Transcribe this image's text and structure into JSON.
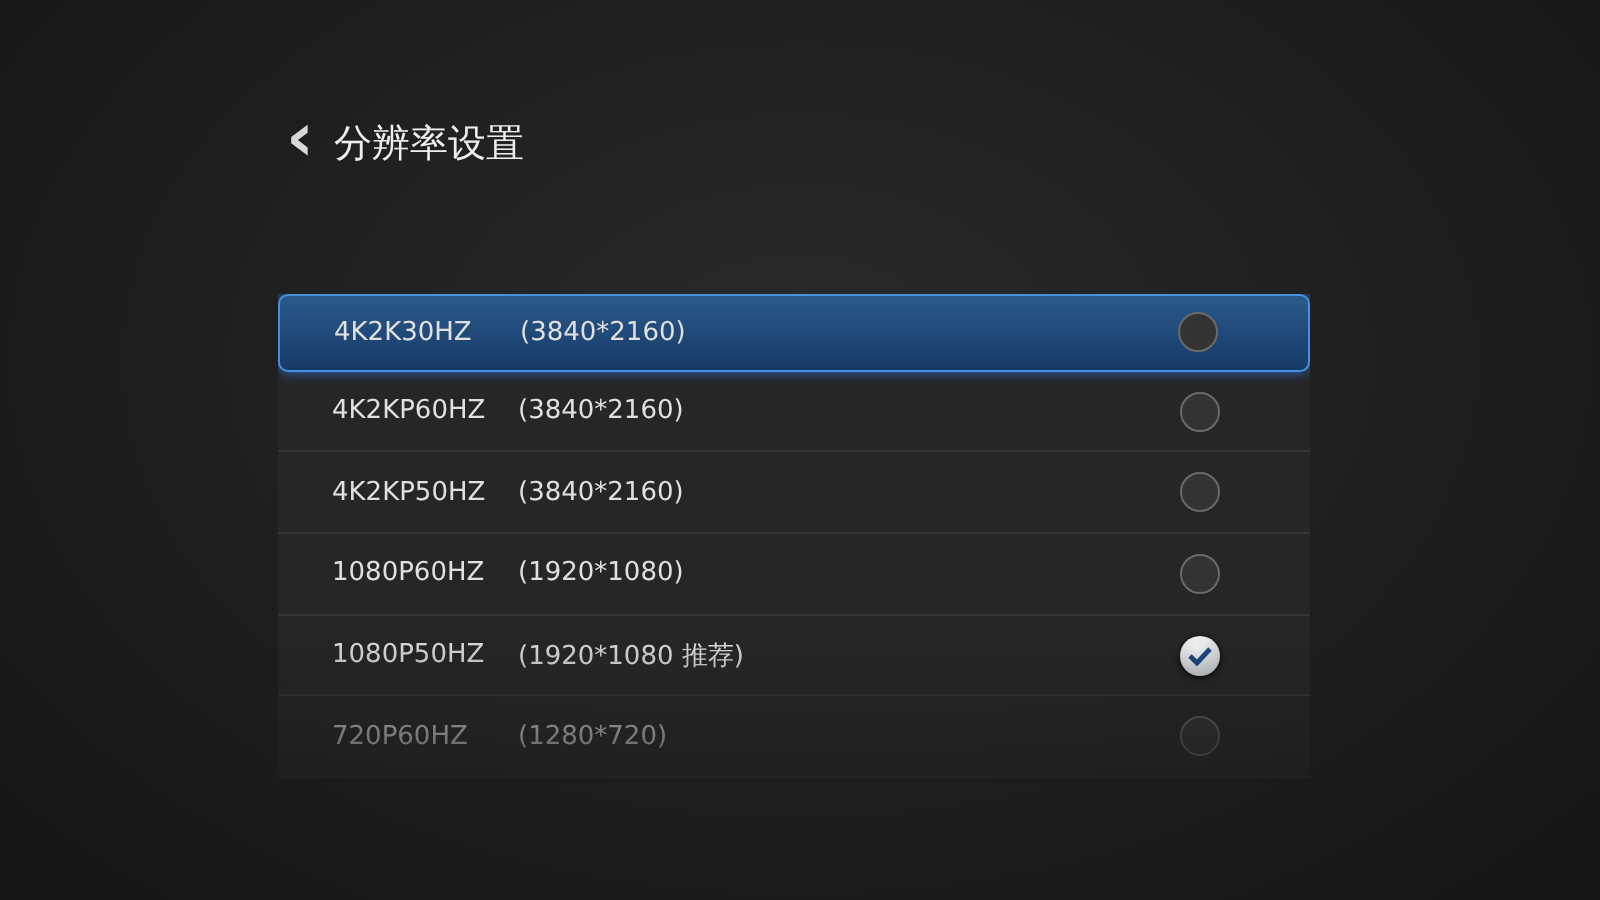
{
  "header": {
    "back": "‹",
    "title": "分辨率设置"
  },
  "options": [
    {
      "mode": "4K2K30HZ",
      "resolution": "(3840*2160)",
      "focused": true,
      "checked": false
    },
    {
      "mode": "4K2KP60HZ",
      "resolution": "(3840*2160)",
      "focused": false,
      "checked": false
    },
    {
      "mode": "4K2KP50HZ",
      "resolution": "(3840*2160)",
      "focused": false,
      "checked": false
    },
    {
      "mode": "1080P60HZ",
      "resolution": "(1920*1080)",
      "focused": false,
      "checked": false
    },
    {
      "mode": "1080P50HZ",
      "resolution": "(1920*1080 推荐)",
      "focused": false,
      "checked": true
    },
    {
      "mode": "720P60HZ",
      "resolution": "(1280*720)",
      "focused": false,
      "checked": false
    }
  ]
}
